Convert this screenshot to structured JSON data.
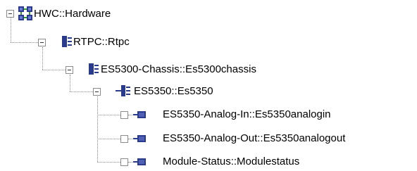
{
  "tree": {
    "nodes": [
      {
        "label": "HWC::Hardware",
        "icon": "hardware-network-icon",
        "expanded": true
      },
      {
        "label": "RTPC::Rtpc",
        "icon": "module-icon",
        "expanded": true
      },
      {
        "label": "ES5300-Chassis::Es5300chassis",
        "icon": "module-icon",
        "expanded": true
      },
      {
        "label": "ES5350::Es5350",
        "icon": "submodule-icon",
        "expanded": true
      },
      {
        "label": "ES5350-Analog-In::Es5350analogin",
        "icon": "leaf-module-icon",
        "expanded": false
      },
      {
        "label": "ES5350-Analog-Out::Es5350analogout",
        "icon": "leaf-module-icon",
        "expanded": false
      },
      {
        "label": "Module-Status::Modulestatus",
        "icon": "leaf-module-icon",
        "expanded": false
      }
    ]
  },
  "colors": {
    "icon_blue": "#2a3a8c",
    "icon_green": "#2f9e2f",
    "connector": "#8a8a8a"
  }
}
